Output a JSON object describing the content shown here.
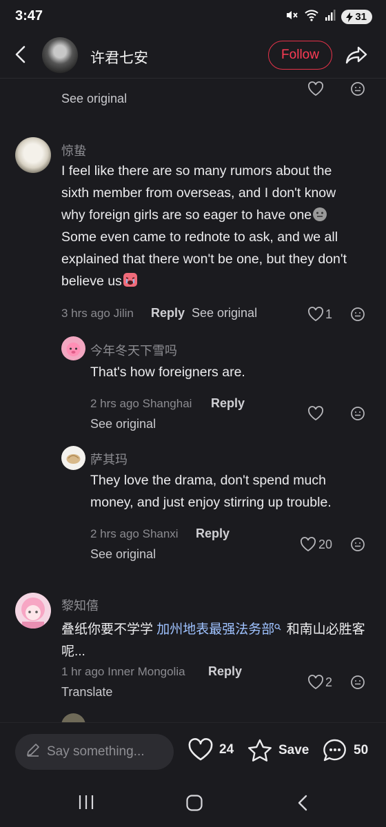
{
  "status_bar": {
    "time": "3:47",
    "battery": "31"
  },
  "header": {
    "username": "许君七安",
    "follow_label": "Follow"
  },
  "comments": {
    "prev": {
      "see_original": "See original"
    },
    "c1": {
      "author": "惊蛰",
      "text_lines": [
        "I feel like there are so many rumors about the",
        "sixth member from overseas, and I don't know",
        "why foreign girls are so eager to have one",
        "Some even came to rednote to ask, and we all",
        "explained that there won't be one, but they don't",
        "believe us"
      ],
      "meta": "3 hrs ago Jilin",
      "reply": "Reply",
      "see_original": "See original",
      "likes": "1"
    },
    "r1": {
      "author": "今年冬天下雪吗",
      "text": "That's how foreigners are.",
      "meta": "2 hrs ago Shanghai",
      "reply": "Reply",
      "see_original": "See original"
    },
    "r2": {
      "author": "萨其玛",
      "text_lines": [
        "They love the drama, don't spend much",
        "money, and just enjoy stirring up trouble."
      ],
      "meta": "2 hrs ago Shanxi",
      "reply": "Reply",
      "see_original": "See original",
      "likes": "20"
    },
    "c2": {
      "author": "黎知僖",
      "text_prefix": "叠纸你要不学学 ",
      "text_link": "加州地表最强法务部",
      "text_suffix": " 和南山必胜客",
      "text_line2": "呢...",
      "meta": "1 hr ago Inner Mongolia",
      "reply": "Reply",
      "translate": "Translate",
      "likes": "2"
    }
  },
  "bottom_bar": {
    "input_placeholder": "Say something...",
    "likes": "24",
    "save_label": "Save",
    "comments": "50"
  },
  "colors": {
    "accent": "#ff3b55",
    "background": "#1b1b1f",
    "link": "#9fc2ff"
  }
}
